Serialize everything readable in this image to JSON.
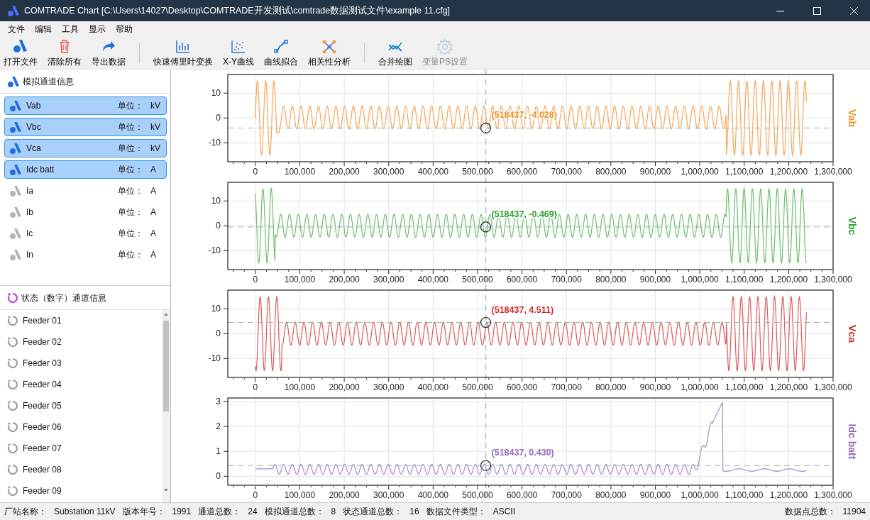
{
  "window": {
    "title": "COMTRADE Chart [C:\\Users\\14027\\Desktop\\COMTRADE开发测试\\comtrade数据测试文件\\example 11.cfg]"
  },
  "menu": [
    "文件",
    "编辑",
    "工具",
    "显示",
    "帮助"
  ],
  "toolbar": [
    [
      {
        "label": "打开文件",
        "disabled": false
      },
      {
        "label": "清除所有",
        "disabled": false
      },
      {
        "label": "导出数据",
        "disabled": false
      }
    ],
    [
      {
        "label": "快速傅里叶变换",
        "disabled": false
      },
      {
        "label": "X-Y曲线",
        "disabled": false
      },
      {
        "label": "曲线拟合",
        "disabled": false
      },
      {
        "label": "相关性分析",
        "disabled": false
      }
    ],
    [
      {
        "label": "合并绘图",
        "disabled": false
      },
      {
        "label": "变量PS设置",
        "disabled": true
      }
    ]
  ],
  "analog_panel": {
    "title": "模拟通道信息",
    "channels": [
      {
        "name": "Vab",
        "unit_label": "单位：",
        "unit": "kV",
        "selected": true
      },
      {
        "name": "Vbc",
        "unit_label": "单位：",
        "unit": "kV",
        "selected": true
      },
      {
        "name": "Vca",
        "unit_label": "单位：",
        "unit": "kV",
        "selected": true
      },
      {
        "name": "Idc batt",
        "unit_label": "单位：",
        "unit": "A",
        "selected": true
      },
      {
        "name": "Ia",
        "unit_label": "单位：",
        "unit": "A",
        "selected": false
      },
      {
        "name": "Ib",
        "unit_label": "单位：",
        "unit": "A",
        "selected": false
      },
      {
        "name": "Ic",
        "unit_label": "单位：",
        "unit": "A",
        "selected": false
      },
      {
        "name": "In",
        "unit_label": "单位：",
        "unit": "A",
        "selected": false
      }
    ]
  },
  "digital_panel": {
    "title": "状态（数字）通道信息",
    "channels": [
      "Feeder 01",
      "Feeder 02",
      "Feeder 03",
      "Feeder 04",
      "Feeder 05",
      "Feeder 06",
      "Feeder 07",
      "Feeder 08",
      "Feeder 09"
    ]
  },
  "charts": [
    {
      "label": "Vab",
      "color": "#f08c1e",
      "readout": "(518437, -4.028)",
      "yticks": [
        "10",
        "0",
        "-10"
      ],
      "xticks": [
        "0",
        "100,000",
        "200,000",
        "300,000",
        "400,000",
        "500,000",
        "600,000",
        "700,000",
        "800,000",
        "900,000",
        "1,000,000",
        "1,100,000",
        "1,200,000",
        "1,300,000"
      ]
    },
    {
      "label": "Vbc",
      "color": "#2ca02c",
      "readout": "(518437, -0.469)",
      "yticks": [
        "10",
        "0",
        "-10"
      ],
      "xticks": [
        "0",
        "100,000",
        "200,000",
        "300,000",
        "400,000",
        "500,000",
        "600,000",
        "700,000",
        "800,000",
        "900,000",
        "1,000,000",
        "1,100,000",
        "1,200,000",
        "1,300,000"
      ]
    },
    {
      "label": "Vca",
      "color": "#d62728",
      "readout": "(518437, 4.511)",
      "yticks": [
        "10",
        "0",
        "-10"
      ],
      "xticks": [
        "0",
        "100,000",
        "200,000",
        "300,000",
        "400,000",
        "500,000",
        "600,000",
        "700,000",
        "800,000",
        "900,000",
        "1,000,000",
        "1,100,000",
        "1,200,000",
        "1,300,000"
      ]
    },
    {
      "label": "Idc batt",
      "color": "#9467bd",
      "readout": "(518437, 0.430)",
      "yticks": [
        "3",
        "2",
        "1",
        "0"
      ],
      "xticks": [
        "0",
        "100,000",
        "200,000",
        "300,000",
        "400,000",
        "500,000",
        "600,000",
        "700,000",
        "800,000",
        "900,000",
        "1,000,000",
        "1,100,000",
        "1,200,000",
        "1,300,000"
      ]
    }
  ],
  "status_bar": {
    "items": [
      {
        "label": "厂站名称：",
        "value": "Substation 11kV"
      },
      {
        "label": "版本年号：",
        "value": "1991"
      },
      {
        "label": "通道总数：",
        "value": "24"
      },
      {
        "label": "模拟通道总数：",
        "value": "8"
      },
      {
        "label": "状态通道总数：",
        "value": "16"
      },
      {
        "label": "数据文件类型：",
        "value": "ASCII"
      }
    ],
    "right": {
      "label": "数据点总数：",
      "value": "11904"
    }
  }
}
